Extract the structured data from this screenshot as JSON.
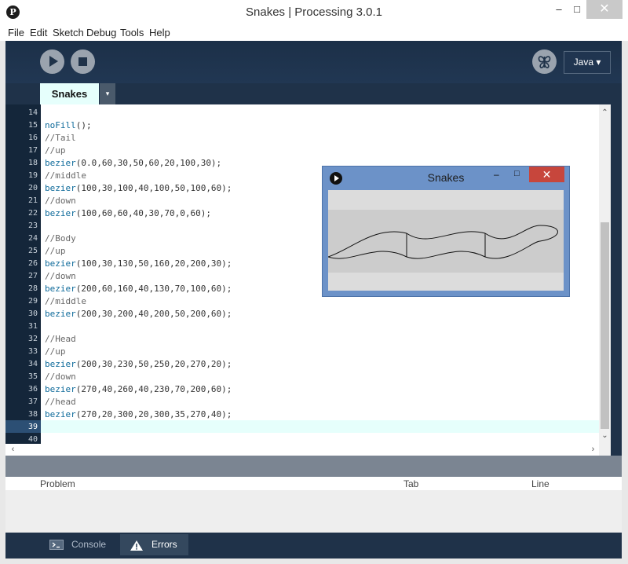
{
  "window": {
    "app_icon": "P",
    "title": "Snakes | Processing 3.0.1",
    "min_icon": "minimize-icon",
    "max_icon": "maximize-icon",
    "close_icon": "close-icon"
  },
  "menu": [
    "File",
    "Edit",
    "Sketch",
    "Debug",
    "Tools",
    "Help"
  ],
  "toolbar": {
    "run_icon": "play-icon",
    "stop_icon": "stop-icon",
    "debug_icon": "butterfly-icon",
    "mode": "Java ▾"
  },
  "tabs": {
    "active": "Snakes",
    "menu_icon": "▾"
  },
  "editor": {
    "current_line": 39,
    "lines": [
      {
        "n": "14",
        "text": ""
      },
      {
        "n": "15",
        "text": "noFill();"
      },
      {
        "n": "16",
        "text": "//Tail"
      },
      {
        "n": "17",
        "text": "//up"
      },
      {
        "n": "18",
        "text": "bezier(0.0,60,30,50,60,20,100,30);"
      },
      {
        "n": "19",
        "text": "//middle"
      },
      {
        "n": "20",
        "text": "bezier(100,30,100,40,100,50,100,60);"
      },
      {
        "n": "21",
        "text": "//down"
      },
      {
        "n": "22",
        "text": "bezier(100,60,60,40,30,70,0,60);"
      },
      {
        "n": "23",
        "text": ""
      },
      {
        "n": "24",
        "text": "//Body"
      },
      {
        "n": "25",
        "text": "//up"
      },
      {
        "n": "26",
        "text": "bezier(100,30,130,50,160,20,200,30);"
      },
      {
        "n": "27",
        "text": "//down"
      },
      {
        "n": "28",
        "text": "bezier(200,60,160,40,130,70,100,60);"
      },
      {
        "n": "29",
        "text": "//middle"
      },
      {
        "n": "30",
        "text": "bezier(200,30,200,40,200,50,200,60);"
      },
      {
        "n": "31",
        "text": ""
      },
      {
        "n": "32",
        "text": "//Head"
      },
      {
        "n": "33",
        "text": "//up"
      },
      {
        "n": "34",
        "text": "bezier(200,30,230,50,250,20,270,20);"
      },
      {
        "n": "35",
        "text": "//down"
      },
      {
        "n": "36",
        "text": "bezier(270,40,260,40,230,70,200,60);"
      },
      {
        "n": "37",
        "text": "//head"
      },
      {
        "n": "38",
        "text": "bezier(270,20,300,20,300,35,270,40);"
      },
      {
        "n": "39",
        "text": ""
      },
      {
        "n": "40",
        "text": ""
      }
    ]
  },
  "errors_table": {
    "columns": [
      "Problem",
      "Tab",
      "Line"
    ]
  },
  "bottom_tabs": {
    "console": "Console",
    "errors": "Errors",
    "console_icon": "console-icon",
    "errors_icon": "warning-icon"
  },
  "sketch_window": {
    "title": "Snakes",
    "run_icon": "play-icon",
    "min_icon": "minimize-icon",
    "max_icon": "maximize-icon",
    "close_icon": "close-icon",
    "background_color": "#dcdcdc",
    "band_color": "#cccccc"
  },
  "colors": {
    "frame": "#1f3249",
    "tab_active": "#e6fffc",
    "code_function": "#0e6a9a",
    "code_comment": "#666666"
  }
}
